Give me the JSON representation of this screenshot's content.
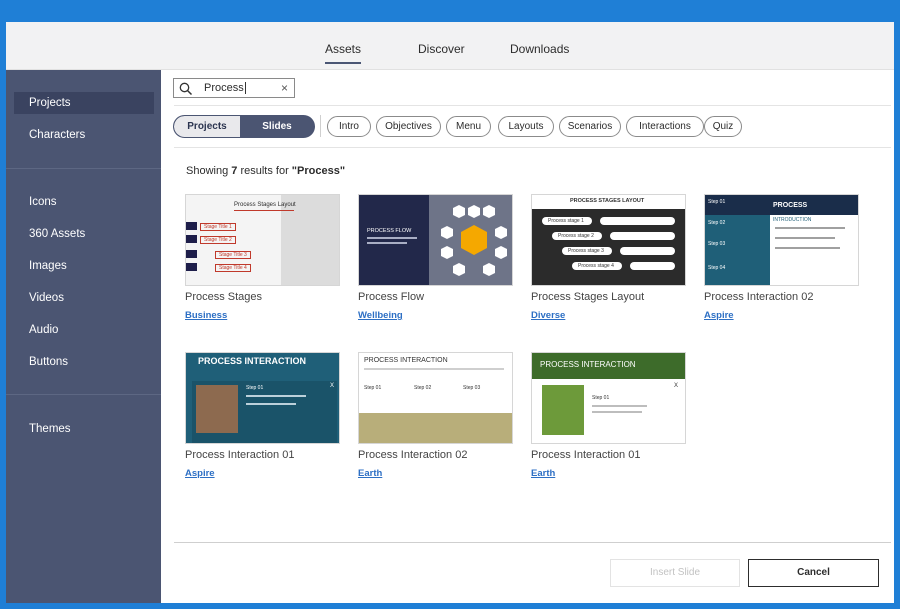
{
  "top_tabs": [
    {
      "label": "Assets",
      "active": true
    },
    {
      "label": "Discover",
      "active": false
    },
    {
      "label": "Downloads",
      "active": false
    }
  ],
  "sidebar": {
    "items": [
      {
        "label": "Projects",
        "active": true
      },
      {
        "label": "Characters"
      },
      {
        "label": "Icons"
      },
      {
        "label": "360 Assets"
      },
      {
        "label": "Images"
      },
      {
        "label": "Videos"
      },
      {
        "label": "Audio"
      },
      {
        "label": "Buttons"
      },
      {
        "label": "Themes"
      }
    ]
  },
  "search": {
    "value": "Process",
    "clear_icon": "×"
  },
  "toggle": {
    "options": [
      "Projects",
      "Slides"
    ],
    "selected": "Slides"
  },
  "filters": [
    "Intro",
    "Objectives",
    "Menu",
    "Layouts",
    "Scenarios",
    "Interactions",
    "Quiz"
  ],
  "results": {
    "prefix": "Showing ",
    "count": "7",
    "middle": " results for ",
    "query": "\"Process\""
  },
  "cards": [
    {
      "title": "Process Stages",
      "tag": "Business",
      "thumb": {
        "heading": "Process Stages Layout",
        "stages": [
          "Stage Title 1",
          "Stage Title 2",
          "Stage Title 3",
          "Stage Title 4"
        ]
      }
    },
    {
      "title": "Process Flow",
      "tag": "Wellbeing",
      "thumb": {
        "heading": "PROCESS FLOW"
      }
    },
    {
      "title": "Process Stages Layout",
      "tag": "Diverse",
      "thumb": {
        "heading": "PROCESS STAGES LAYOUT",
        "stages": [
          "Process stage 1",
          "Process stage 2",
          "Process stage 3",
          "Process stage 4"
        ]
      }
    },
    {
      "title": "Process Interaction 02",
      "tag": "Aspire",
      "thumb": {
        "heading": "PROCESS",
        "sub": "INTRODUCTION",
        "steps": [
          "Step 01",
          "Step 02",
          "Step 03",
          "Step 04"
        ]
      }
    },
    {
      "title": "Process Interaction 01",
      "tag": "Aspire",
      "thumb": {
        "heading": "PROCESS INTERACTION",
        "step": "Step 01",
        "close": "X"
      }
    },
    {
      "title": "Process Interaction 02",
      "tag": "Earth",
      "thumb": {
        "heading": "PROCESS INTERACTION",
        "steps": [
          "Step 01",
          "Step 02",
          "Step 03"
        ]
      }
    },
    {
      "title": "Process Interaction 01",
      "tag": "Earth",
      "thumb": {
        "heading": "PROCESS INTERACTION",
        "step": "Step 01",
        "close": "X"
      }
    }
  ],
  "footer": {
    "insert_label": "Insert Slide",
    "cancel_label": "Cancel"
  },
  "colors": {
    "frame": "#1f7fd6",
    "sidebar": "#4b5572",
    "link": "#2d6fc4",
    "teal": "#1f5f78",
    "olive": "#b8ae7a"
  }
}
